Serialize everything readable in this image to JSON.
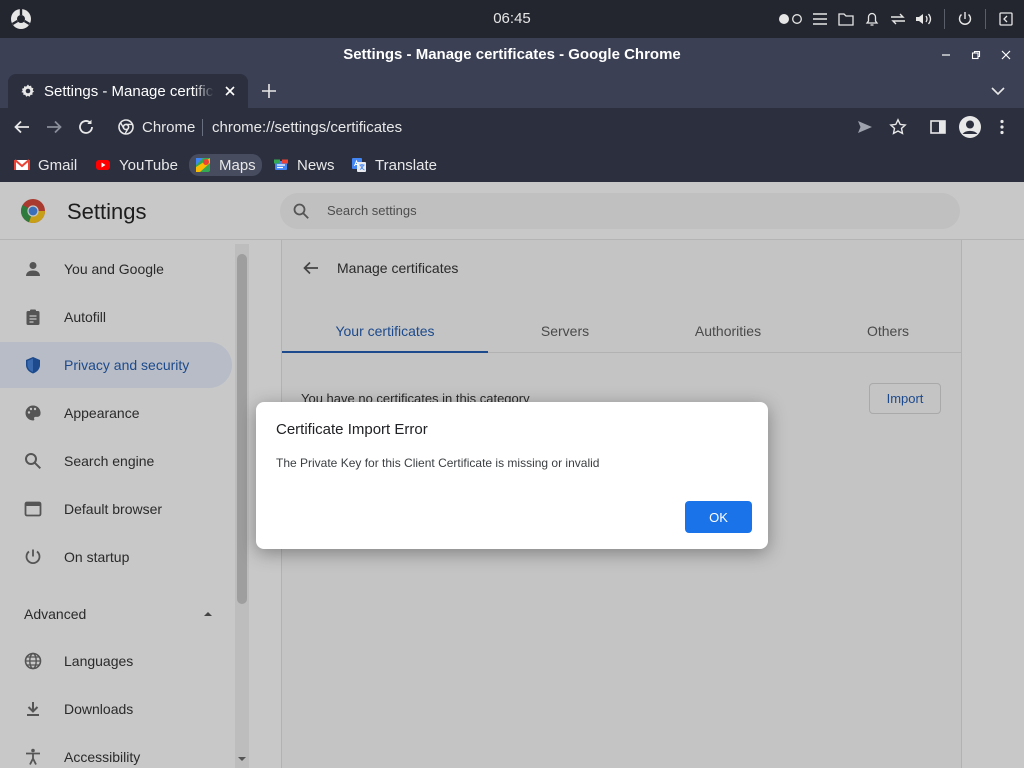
{
  "system_bar": {
    "clock": "06:45",
    "tray_icons": [
      "toggle-icon",
      "menu-icon",
      "folder-icon",
      "bell-icon",
      "network-icon",
      "volume-icon",
      "power-icon",
      "logout-icon"
    ]
  },
  "window": {
    "title": "Settings - Manage certificates - Google Chrome"
  },
  "tabs": [
    {
      "label": "Settings - Manage certificates",
      "icon": "gear-icon",
      "active": true
    }
  ],
  "omnibox": {
    "scheme_label": "Chrome",
    "url": "chrome://settings/certificates"
  },
  "bookmarks": [
    {
      "label": "Gmail",
      "icon": "gmail-icon",
      "color": "#ea4335"
    },
    {
      "label": "YouTube",
      "icon": "youtube-icon",
      "color": "#ff0000"
    },
    {
      "label": "Maps",
      "icon": "maps-icon",
      "color": "#34a853"
    },
    {
      "label": "News",
      "icon": "news-icon",
      "color": "#4285f4"
    },
    {
      "label": "Translate",
      "icon": "translate-icon",
      "color": "#4285f4"
    }
  ],
  "settings": {
    "title": "Settings",
    "search_placeholder": "Search settings",
    "sidebar": [
      {
        "label": "You and Google",
        "icon": "person-icon"
      },
      {
        "label": "Autofill",
        "icon": "clipboard-icon"
      },
      {
        "label": "Privacy and security",
        "icon": "shield-icon",
        "selected": true
      },
      {
        "label": "Appearance",
        "icon": "palette-icon"
      },
      {
        "label": "Search engine",
        "icon": "search-icon"
      },
      {
        "label": "Default browser",
        "icon": "browser-icon"
      },
      {
        "label": "On startup",
        "icon": "power-icon"
      }
    ],
    "advanced_label": "Advanced",
    "advanced_items": [
      {
        "label": "Languages",
        "icon": "globe-icon"
      },
      {
        "label": "Downloads",
        "icon": "download-icon"
      },
      {
        "label": "Accessibility",
        "icon": "accessibility-icon"
      }
    ]
  },
  "certificates": {
    "title": "Manage certificates",
    "tabs": [
      "Your certificates",
      "Servers",
      "Authorities",
      "Others"
    ],
    "empty_text": "You have no certificates in this category",
    "import_label": "Import"
  },
  "dialog": {
    "title": "Certificate Import Error",
    "message": "The Private Key for this Client Certificate is missing or invalid",
    "ok_label": "OK"
  },
  "colors": {
    "accent": "#1a73e8",
    "frame": "#3b4055",
    "toolbar": "#2b2f3e",
    "sysbar": "#23262f"
  }
}
